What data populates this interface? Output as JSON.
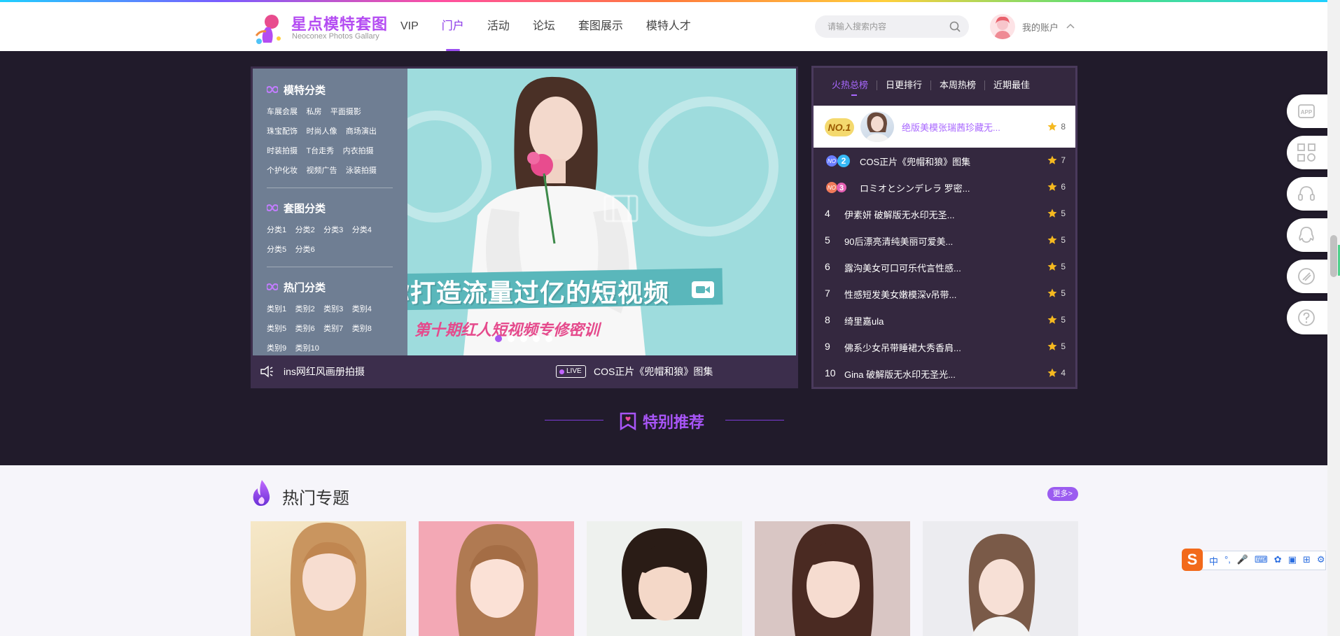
{
  "header": {
    "logo_cn": "星点模特套图",
    "logo_en": "Neoconex Photos Gallary",
    "nav": [
      {
        "label": "VIP",
        "active": false
      },
      {
        "label": "门户",
        "active": true
      },
      {
        "label": "活动",
        "active": false
      },
      {
        "label": "论坛",
        "active": false
      },
      {
        "label": "套图展示",
        "active": false
      },
      {
        "label": "模特人才",
        "active": false
      }
    ],
    "search_placeholder": "请输入搜索内容",
    "account_label": "我的账户"
  },
  "categories": {
    "model": {
      "title": "模特分类",
      "links": [
        "车展会展",
        "私房",
        "平面摄影",
        "珠宝配饰",
        "时尚人像",
        "商场演出",
        "时装拍摄",
        "T台走秀",
        "内衣拍摄",
        "个护化妆",
        "视频广告",
        "泳装拍摄"
      ]
    },
    "album": {
      "title": "套图分类",
      "links": [
        "分类1",
        "分类2",
        "分类3",
        "分类4",
        "分类5",
        "分类6"
      ]
    },
    "hot": {
      "title": "热门分类",
      "links": [
        "类别1",
        "类别2",
        "类别3",
        "类别4",
        "类别5",
        "类别6",
        "类别7",
        "类别8",
        "类别9",
        "类别10"
      ]
    }
  },
  "banner": {
    "slogan": "教你打造流量过亿的短视频",
    "slogan_sub": "第十期红人短视频专修密训",
    "dots": 5,
    "active_dot": 0
  },
  "ticker": {
    "left_text": "ins网红风画册拍摄",
    "live_badge": "LIVE",
    "right_text": "COS正片《兜帽和狼》图集"
  },
  "ranking": {
    "tabs": [
      {
        "label": "火热总榜",
        "active": true
      },
      {
        "label": "日更排行",
        "active": false
      },
      {
        "label": "本周热榜",
        "active": false
      },
      {
        "label": "近期最佳",
        "active": false
      }
    ],
    "top": {
      "badge": "NO.1",
      "title": "绝版美模张瑞茜珍藏无...",
      "score": "8"
    },
    "rows": [
      {
        "rank": "2",
        "title": "COS正片《兜帽和狼》图集",
        "score": "7"
      },
      {
        "rank": "3",
        "title": "ロミオとシンデレラ 罗密...",
        "score": "6"
      },
      {
        "rank": "4",
        "title": "伊素妍 破解版无水印无圣...",
        "score": "5"
      },
      {
        "rank": "5",
        "title": "90后漂亮清纯美丽可爱美...",
        "score": "5"
      },
      {
        "rank": "6",
        "title": "露沟美女可口可乐代言性感...",
        "score": "5"
      },
      {
        "rank": "7",
        "title": "性感短发美女嫩模深v吊带...",
        "score": "5"
      },
      {
        "rank": "8",
        "title": "绮里嘉ula",
        "score": "5"
      },
      {
        "rank": "9",
        "title": "佛系少女吊带睡裙大秀香肩...",
        "score": "5"
      },
      {
        "rank": "10",
        "title": "Gina 破解版无水印无圣光...",
        "score": "4"
      }
    ]
  },
  "special": {
    "title": "特别推荐"
  },
  "hot_topics": {
    "title": "热门专题",
    "more": "更多>"
  },
  "tools": [
    "app-icon",
    "qrcode-icon",
    "headset-icon",
    "qq-icon",
    "feedback-icon",
    "help-icon"
  ],
  "ime": {
    "logo": "S",
    "mode": "中"
  },
  "colors": {
    "accent": "#a855f7",
    "hero_bg": "#211b2b",
    "panel": "#34283f"
  }
}
